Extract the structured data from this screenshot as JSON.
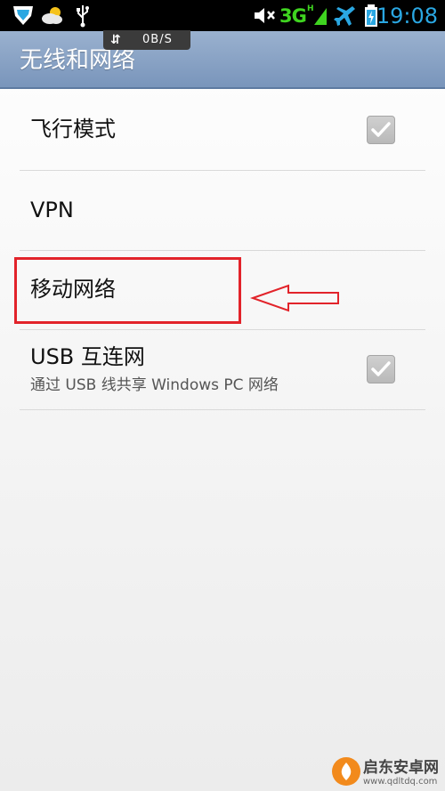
{
  "status_bar": {
    "time": "19:08",
    "network": "3G",
    "network_sub": "H",
    "icons": [
      "shield-notification-icon",
      "weather-icon",
      "usb-icon",
      "mute-icon",
      "signal-icon",
      "airplane-icon",
      "battery-charging-icon"
    ]
  },
  "header": {
    "title": "无线和网络",
    "speed": "0B/S",
    "speed_arrows": "⇵"
  },
  "list": {
    "items": [
      {
        "label": "飞行模式",
        "checked": true
      },
      {
        "label": "VPN"
      },
      {
        "label": "移动网络"
      },
      {
        "label": "USB 互连网",
        "sublabel": "通过 USB 线共享 Windows PC 网络",
        "checked": true
      }
    ]
  },
  "annotation": {
    "color": "#e2232a"
  },
  "watermark": {
    "text": "启东安卓网",
    "url": "www.qdltdq.com"
  },
  "colors": {
    "title_bar": "#8aa4c6",
    "status_time": "#2aa7e2",
    "status_3g": "#3fd420"
  }
}
